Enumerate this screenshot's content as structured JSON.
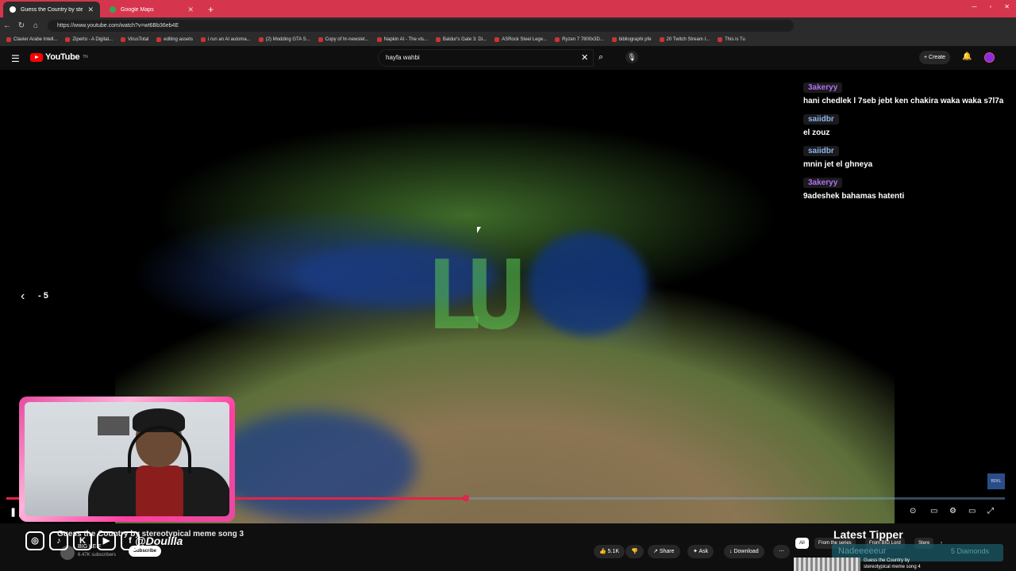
{
  "browser": {
    "tabs": [
      {
        "label": "Guess the Country by stereot",
        "active": true
      },
      {
        "label": "Google Maps",
        "active": false
      }
    ],
    "url": "https://www.youtube.com/watch?v=wt6Bb36eb4E",
    "bookmarks": [
      "Clavier Arabe Intell...",
      "Ziperto - A Digital...",
      "VirusTotal",
      "editing assets",
      "i run an AI automa...",
      "(2) Modding GTA S...",
      "Copy of hr-newslet...",
      "Napkin AI - The vis...",
      "Baldur's Gate 3: Di...",
      "ASRock Steel Lege...",
      "Ryzen 7 7800x3D...",
      "bibliographi pfe",
      "20 Twitch Stream I...",
      "This is Tu"
    ]
  },
  "youtube": {
    "logo": "YouTube",
    "logo_sup": "TN",
    "search_query": "hayfa wahbi",
    "create_label": "Create"
  },
  "video": {
    "seek_label": "- 5",
    "progress": 0.46,
    "watermark": "BDKL",
    "map_glyph": "LU"
  },
  "chat": [
    {
      "user": "3akeryy",
      "text": "hani chedlek l 7seb jebt ken chakira waka waka s7l7a",
      "color": "#b26ef5"
    },
    {
      "user": "saiidbr",
      "text": "el zouz",
      "color": "#8fb4f0"
    },
    {
      "user": "saiidbr",
      "text": "mnin jet el ghneya",
      "color": "#8fb4f0"
    },
    {
      "user": "3akeryy",
      "text": "9adeshek bahamas hatenti",
      "color": "#b26ef5"
    }
  ],
  "below": {
    "video_title": "Guess the Country by stereotypical meme song 3",
    "handle": "@Doullla",
    "channel_name": "BIG KEIF",
    "subscribers": "6.47K subscribers",
    "subscribe_label": "Subscribe",
    "likes": "5.1K",
    "share": "Share",
    "ask": "Ask",
    "download": "Download",
    "chips": [
      "All",
      "From the series",
      "From BIG Lord",
      "Stere"
    ],
    "latest_tipper_title": "Latest Tipper",
    "tipper_name": "Nadeeeeeur",
    "tipper_amount": "5 Diamonds",
    "rec_title": "Guess the Country by stereotypical meme song 4"
  },
  "colors": {
    "tab_bar": "#d6364d",
    "progress": "#e0254a",
    "webcam_border": "#e84aa0"
  }
}
